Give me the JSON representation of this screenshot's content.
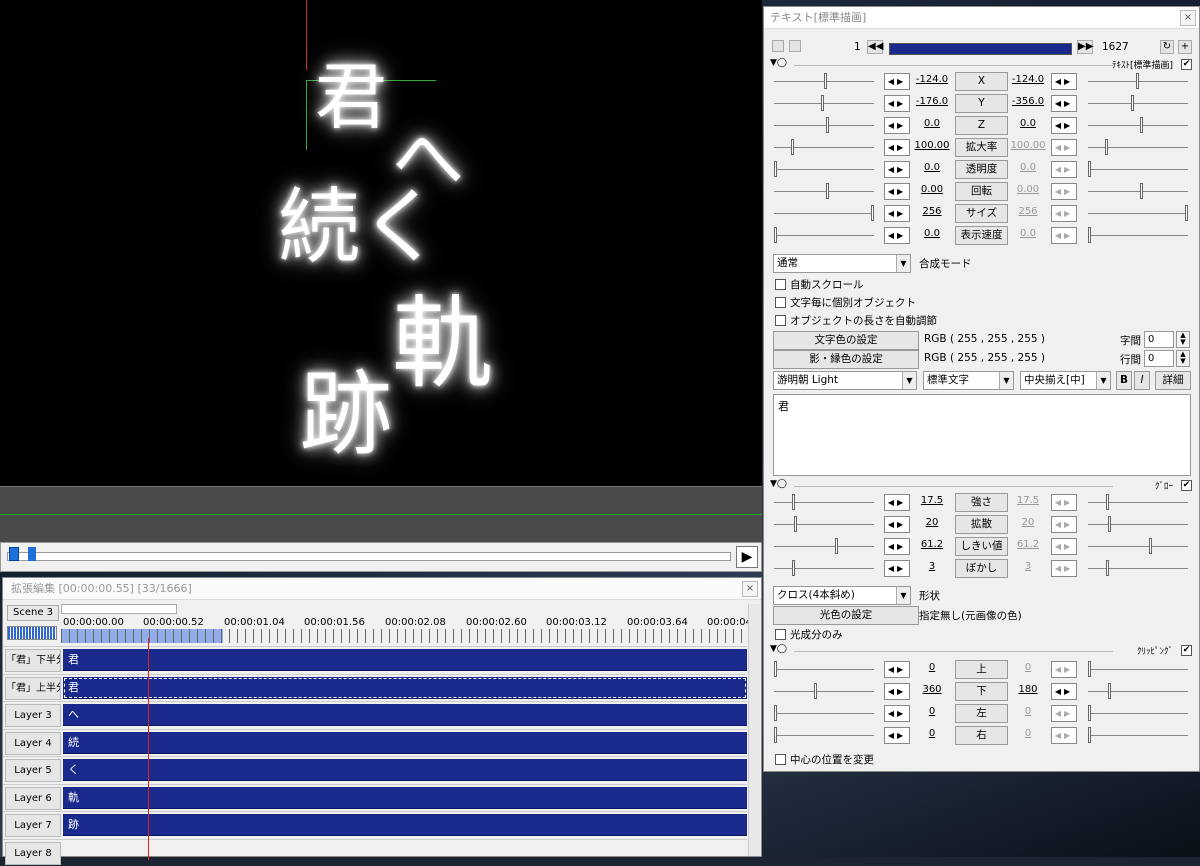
{
  "preview": {
    "glyphs": [
      "君",
      "へ",
      "続",
      "く",
      "軌",
      "跡"
    ]
  },
  "timeline": {
    "title": "拡張編集 [00:00:00.55] [33/1666]",
    "close": "×",
    "scene": "Scene 3",
    "ruler_labels": [
      "00:00:00.00",
      "00:00:00.52",
      "00:00:01.04",
      "00:00:01.56",
      "00:00:02.08",
      "00:00:02.60",
      "00:00:03.12",
      "00:00:03.64",
      "00:00:04"
    ],
    "layers": [
      {
        "name": "「君」下半分",
        "clip": "君"
      },
      {
        "name": "「君」上半分",
        "clip": "君"
      },
      {
        "name": "Layer 3",
        "clip": "へ"
      },
      {
        "name": "Layer 4",
        "clip": "続"
      },
      {
        "name": "Layer 5",
        "clip": "く"
      },
      {
        "name": "Layer 6",
        "clip": "軌"
      },
      {
        "name": "Layer 7",
        "clip": "跡"
      },
      {
        "name": "Layer 8",
        "clip": ""
      }
    ]
  },
  "panel": {
    "title": "テキスト[標準描画]",
    "close": "×",
    "frame_start": "1",
    "frame_end": "1627",
    "section_text": "ﾃｷｽﾄ[標準描画]",
    "params": [
      {
        "v1": "-124.0",
        "label": "X",
        "v2": "-124.0",
        "v2dim": false
      },
      {
        "v1": "-176.0",
        "label": "Y",
        "v2": "-356.0",
        "v2dim": false
      },
      {
        "v1": "0.0",
        "label": "Z",
        "v2": "0.0",
        "v2dim": false
      },
      {
        "v1": "100.00",
        "label": "拡大率",
        "v2": "100.00",
        "v2dim": true
      },
      {
        "v1": "0.0",
        "label": "透明度",
        "v2": "0.0",
        "v2dim": true
      },
      {
        "v1": "0.00",
        "label": "回転",
        "v2": "0.00",
        "v2dim": true
      },
      {
        "v1": "256",
        "label": "サイズ",
        "v2": "256",
        "v2dim": true
      },
      {
        "v1": "0.0",
        "label": "表示速度",
        "v2": "0.0",
        "v2dim": true
      }
    ],
    "blend_mode": "通常",
    "blend_label": "合成モード",
    "checks": [
      "自動スクロール",
      "文字毎に個別オブジェクト",
      "オブジェクトの長さを自動調節"
    ],
    "text_color_btn": "文字色の設定",
    "text_color_val": "RGB ( 255 , 255 , 255 )",
    "shadow_color_btn": "影・縁色の設定",
    "shadow_color_val": "RGB ( 255 , 255 , 255 )",
    "char_spacing_label": "字間",
    "char_spacing": "0",
    "line_spacing_label": "行間",
    "line_spacing": "0",
    "font": "游明朝 Light",
    "style": "標準文字",
    "align": "中央揃え[中]",
    "bold": "B",
    "italic": "I",
    "detail": "詳細",
    "text": "君",
    "section_glow": "ｸﾞﾛｰ",
    "glow_params": [
      {
        "v1": "17.5",
        "label": "強さ",
        "v2": "17.5"
      },
      {
        "v1": "20",
        "label": "拡散",
        "v2": "20"
      },
      {
        "v1": "61.2",
        "label": "しきい値",
        "v2": "61.2"
      },
      {
        "v1": "3",
        "label": "ぼかし",
        "v2": "3"
      }
    ],
    "shape": "クロス(4本斜め)",
    "shape_label": "形状",
    "glow_color_btn": "光色の設定",
    "glow_color_val": "指定無し(元画像の色)",
    "glow_only": "光成分のみ",
    "section_clip": "ｸﾘｯﾋﾟﾝｸﾞ",
    "clip_params": [
      {
        "v1": "0",
        "label": "上",
        "v2": "0"
      },
      {
        "v1": "360",
        "label": "下",
        "v2": "180"
      },
      {
        "v1": "0",
        "label": "左",
        "v2": "0"
      },
      {
        "v1": "0",
        "label": "右",
        "v2": "0"
      }
    ],
    "center_change": "中心の位置を変更"
  }
}
